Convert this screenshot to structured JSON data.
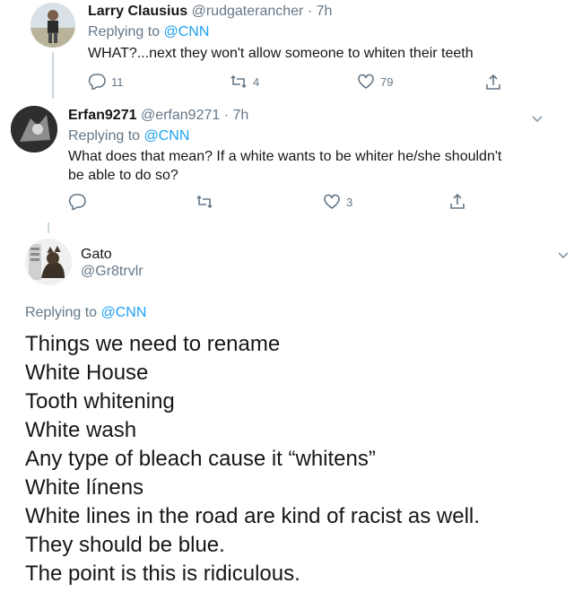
{
  "tweets": [
    {
      "name": "Larry Clausius",
      "handle": "@rudgaterancher",
      "time": "· 7h",
      "replying_prefix": "Replying to",
      "replying_to": "@CNN",
      "text": "WHAT?...next they won't allow someone to whiten their teeth",
      "replies": "11",
      "retweets": "4",
      "likes": "79"
    },
    {
      "name": "Erfan9271",
      "handle": "@erfan9271",
      "time": "· 7h",
      "replying_prefix": "Replying to",
      "replying_to": "@CNN",
      "text_line1": "What does that mean? If a white wants to be whiter he/she shouldn't",
      "text_line2": "be able to do so?",
      "replies": "",
      "retweets": "",
      "likes": "3"
    }
  ],
  "main_tweet": {
    "name": "Gato",
    "handle": "@Gr8trvlr",
    "replying_prefix": "Replying to",
    "replying_to": "@CNN",
    "lines": [
      "Things we need to rename",
      "White House",
      "Tooth whitening",
      "White wash",
      "Any type of bleach cause it “whitens”",
      "White línens",
      "White lines in the road are kind of racist as well.",
      "They should be blue.",
      "The point is this is ridiculous."
    ]
  },
  "icons": {
    "reply": "reply-icon",
    "retweet": "retweet-icon",
    "like": "heart-icon",
    "share": "share-icon",
    "more": "chevron-down-icon"
  },
  "colors": {
    "link": "#1da1f2",
    "muted": "#657786",
    "text": "#14171a",
    "divider": "#e6ecf0"
  }
}
